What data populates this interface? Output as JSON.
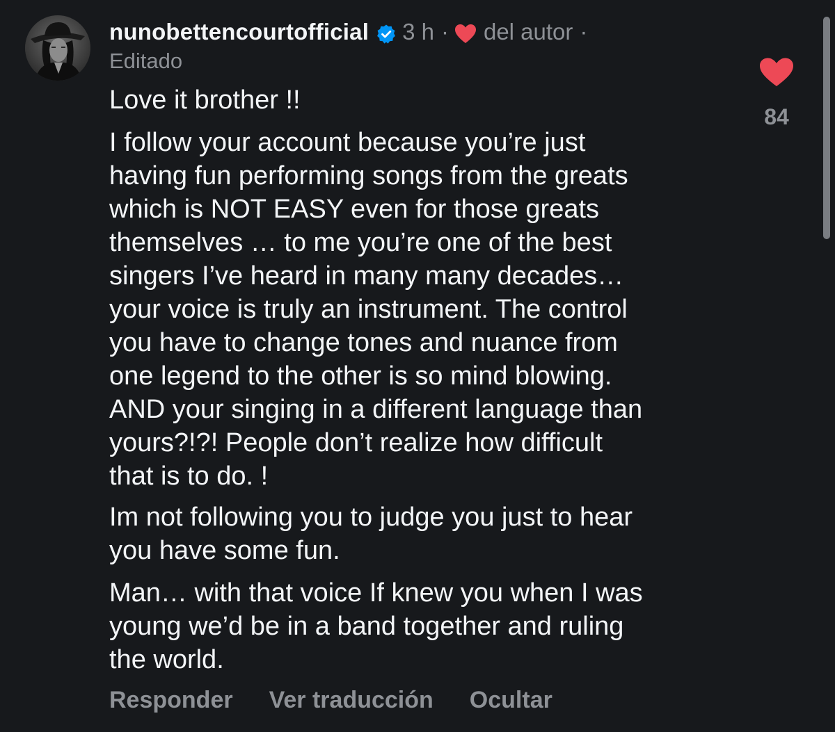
{
  "comment": {
    "username": "nunobettencourtofficial",
    "time": "3 h",
    "separator": "·",
    "author_liked_label": "del autor",
    "edited_label": "Editado",
    "paragraphs": [
      "Love it brother !!",
      "I follow your account because you’re just\nhaving fun performing songs from the greats\nwhich is NOT EASY even for those greats\nthemselves … to me you’re one of the best\nsingers I’ve heard in many many decades…\nyour voice is truly an instrument. The control\nyou have to change tones and nuance from\none legend to the other is so mind blowing.\nAND your singing in a different language than\nyours?!?! People don’t realize how difficult\nthat is to do. !",
      "Im not following you to judge you just to hear\nyou have some fun.",
      "Man… with that voice If knew you when I was\nyoung we’d be in a band together and ruling\nthe world."
    ],
    "like_count": "84",
    "actions": {
      "reply": "Responder",
      "translate": "Ver traducción",
      "hide": "Ocultar"
    }
  },
  "colors": {
    "background": "#17191c",
    "text": "#f3f5f7",
    "muted": "#8e9196",
    "heart_red": "#ed4956",
    "verified_blue": "#0095f6"
  },
  "icons": {
    "avatar": "user-avatar-photo",
    "verified": "verified-badge-icon",
    "author_heart": "heart-filled-icon",
    "like": "heart-filled-icon"
  }
}
